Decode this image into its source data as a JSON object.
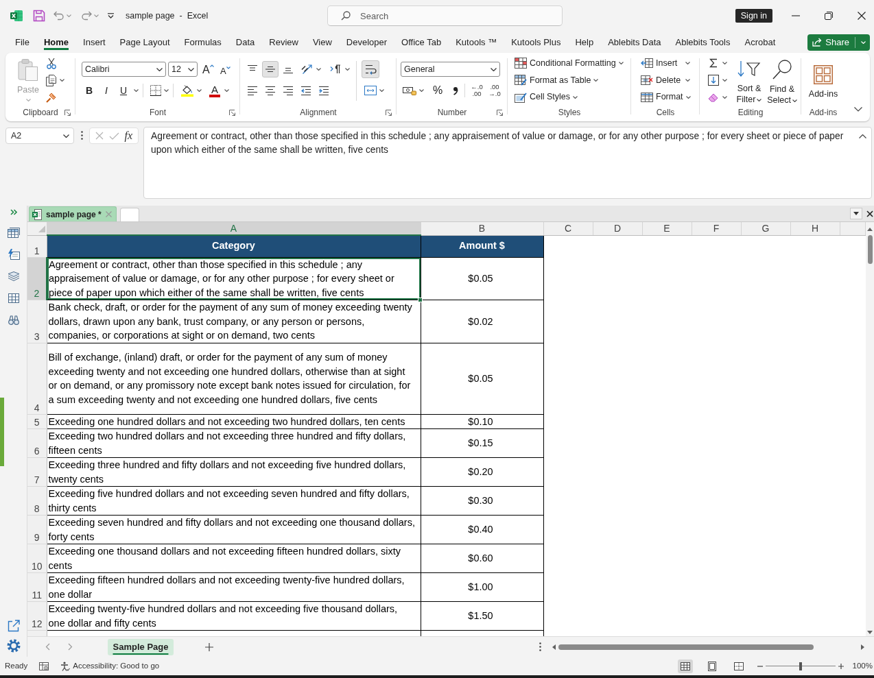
{
  "window": {
    "title": "sample page  -  Excel",
    "search": {
      "placeholder": "Search"
    },
    "sign_in": "Sign in"
  },
  "ribbon_tabs": [
    {
      "label": "File",
      "selected": false
    },
    {
      "label": "Home",
      "selected": true
    },
    {
      "label": "Insert",
      "selected": false
    },
    {
      "label": "Page Layout",
      "selected": false
    },
    {
      "label": "Formulas",
      "selected": false
    },
    {
      "label": "Data",
      "selected": false
    },
    {
      "label": "Review",
      "selected": false
    },
    {
      "label": "View",
      "selected": false
    },
    {
      "label": "Developer",
      "selected": false
    },
    {
      "label": "Office Tab",
      "selected": false
    },
    {
      "label": "Kutools ™",
      "selected": false
    },
    {
      "label": "Kutools Plus",
      "selected": false
    },
    {
      "label": "Help",
      "selected": false
    },
    {
      "label": "Ablebits Data",
      "selected": false
    },
    {
      "label": "Ablebits Tools",
      "selected": false
    },
    {
      "label": "Acrobat",
      "selected": false
    }
  ],
  "share": "Share",
  "ribbon": {
    "clipboard": {
      "label": "Clipboard",
      "paste": "Paste",
      "paste_disabled": true
    },
    "font": {
      "label": "Font",
      "font_name": "Calibri",
      "font_size": "12",
      "grow": "A",
      "shrink": "A",
      "bold": "B",
      "italic": "I",
      "underline": "U",
      "font_color": "A"
    },
    "alignment": {
      "label": "Alignment",
      "vertical": [
        {
          "kind": "top",
          "on": false
        },
        {
          "kind": "middle",
          "on": true
        },
        {
          "kind": "bottom",
          "on": false
        }
      ],
      "horizontal": [
        {
          "kind": "left",
          "on": false
        },
        {
          "kind": "center",
          "on": false
        },
        {
          "kind": "right",
          "on": false
        }
      ],
      "wrap_text_on": true
    },
    "number": {
      "label": "Number",
      "format": "General",
      "percent": "%",
      "decimals": [
        {
          "top": "←.0",
          "bottom": ".00"
        },
        {
          "top": ".00",
          "bottom": "→.0"
        }
      ]
    },
    "styles": {
      "label": "Styles",
      "items": [
        {
          "kind": "conditional",
          "label": "Conditional Formatting"
        },
        {
          "kind": "table",
          "label": "Format as Table"
        },
        {
          "kind": "cell",
          "label": "Cell Styles"
        }
      ]
    },
    "cells": {
      "label": "Cells",
      "items": [
        {
          "kind": "insert",
          "label": "Insert"
        },
        {
          "kind": "delete",
          "label": "Delete"
        },
        {
          "kind": "format",
          "label": "Format"
        }
      ]
    },
    "editing": {
      "label": "Editing",
      "sort": "Sort & Filter",
      "find": "Find & Select"
    },
    "addins": {
      "label": "Add-ins",
      "button": "Add-ins"
    }
  },
  "formula_bar": {
    "name_box": "A2",
    "fx": "fx",
    "formula": "Agreement or contract, other than those specified in this schedule ; any appraisement of value or damage, or for any other purpose ; for every sheet or piece of paper upon which either of the same shall be written, five cents"
  },
  "document_tabs": [
    {
      "label": "sample page *",
      "selected": true
    }
  ],
  "sheet": {
    "columns": [
      {
        "label": "A",
        "selected": true
      },
      {
        "label": "B",
        "selected": false
      },
      {
        "label": "C",
        "selected": false
      },
      {
        "label": "D",
        "selected": false
      },
      {
        "label": "E",
        "selected": false
      },
      {
        "label": "F",
        "selected": false
      },
      {
        "label": "G",
        "selected": false
      },
      {
        "label": "H",
        "selected": false
      }
    ],
    "rows": [
      {
        "number": "1",
        "kind": "header",
        "selected": false,
        "cells": [
          "Category",
          "Amount $"
        ]
      },
      {
        "number": "2",
        "kind": "data",
        "selected": true,
        "cells": [
          "Agreement or contract, other than those specified in this schedule ; any appraisement of value or damage, or for any other purpose ; for every sheet or piece of paper upon which either of the same shall be written, five cents",
          "$0.05"
        ]
      },
      {
        "number": "3",
        "kind": "data",
        "selected": false,
        "cells": [
          "Bank check, draft, or order for the payment of any sum of money exceeding twenty dollars, drawn upon any bank, trust company, or any person or persons, companies, or corporations at sight or on demand, two cents",
          "$0.02"
        ]
      },
      {
        "number": "4",
        "kind": "data",
        "selected": false,
        "cells": [
          "Bill of exchange, (inland) draft, or order for the payment of any sum of money exceeding twenty and not exceeding one hundred dollars, otherwise than at sight or on demand, or any promissory note except bank notes issued for circulation, for a sum exceeding twenty and not exceeding one hundred dollars, five cents",
          "$0.05"
        ]
      },
      {
        "number": "5",
        "kind": "data",
        "selected": false,
        "cells": [
          "Exceeding one hundred dollars and not exceeding two hundred dollars, ten cents",
          "$0.10"
        ]
      },
      {
        "number": "6",
        "kind": "data",
        "selected": false,
        "cells": [
          "Exceeding two hundred dollars and not exceeding three hundred and fifty dollars, fifteen cents",
          "$0.15"
        ]
      },
      {
        "number": "7",
        "kind": "data",
        "selected": false,
        "cells": [
          "Exceeding three hundred and fifty dollars and not exceeding five hundred dollars, twenty cents",
          "$0.20"
        ]
      },
      {
        "number": "8",
        "kind": "data",
        "selected": false,
        "cells": [
          "Exceeding five hundred dollars and not exceeding seven hundred and fifty dollars, thirty cents",
          "$0.30"
        ]
      },
      {
        "number": "9",
        "kind": "data",
        "selected": false,
        "cells": [
          "Exceeding seven hundred and fifty dollars and not exceeding one thousand dollars, forty cents",
          "$0.40"
        ]
      },
      {
        "number": "10",
        "kind": "data",
        "selected": false,
        "cells": [
          "Exceeding one thousand dollars and not exceeding fifteen hundred dollars, sixty cents",
          "$0.60"
        ]
      },
      {
        "number": "11",
        "kind": "data",
        "selected": false,
        "cells": [
          "Exceeding fifteen hundred dollars and not exceeding twenty-five hundred dollars, one dollar",
          "$1.00"
        ]
      },
      {
        "number": "12",
        "kind": "data",
        "selected": false,
        "cells": [
          "Exceeding twenty-five hundred dollars and not exceeding five thousand dollars, one dollar and fifty cents",
          "$1.50"
        ]
      }
    ]
  },
  "sheet_tabs": [
    {
      "label": "Sample Page",
      "selected": true
    }
  ],
  "status_bar": {
    "status": "Ready",
    "accessibility": "Accessibility: Good to go",
    "views": [
      {
        "kind": "normal",
        "selected": true
      },
      {
        "kind": "page_layout",
        "selected": false
      },
      {
        "kind": "page_break",
        "selected": false
      }
    ],
    "zoom": {
      "level": 0.5,
      "reading": "100%"
    }
  }
}
